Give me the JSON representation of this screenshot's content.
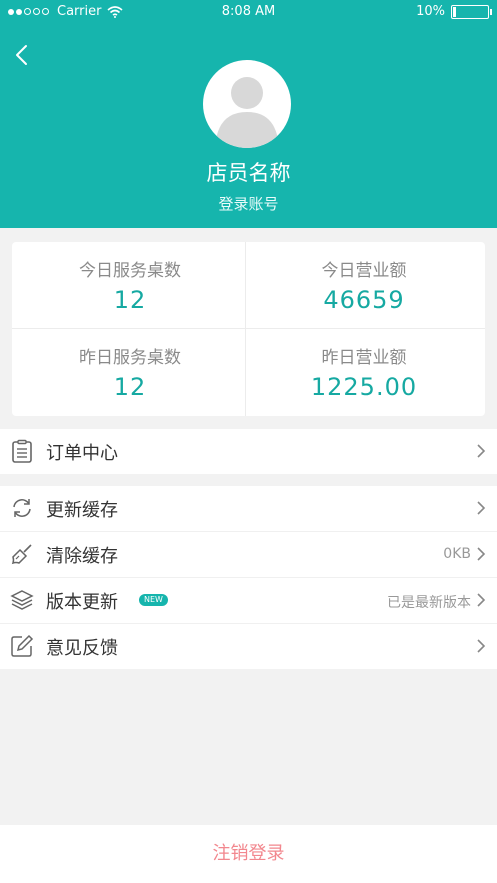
{
  "status_bar": {
    "carrier": "Carrier",
    "time": "8:08 AM",
    "battery": "10%",
    "battery_level": 0.1,
    "signal_bars": 2
  },
  "profile": {
    "name": "店员名称",
    "account": "登录账号",
    "back_icon": "chevron-left-icon",
    "avatar_icon": "user-avatar-icon"
  },
  "stats": [
    {
      "label": "今日服务桌数",
      "value": "12"
    },
    {
      "label": "今日营业额",
      "value": "46659"
    },
    {
      "label": "昨日服务桌数",
      "value": "12"
    },
    {
      "label": "昨日营业额",
      "value": "1225.00"
    }
  ],
  "menu": {
    "orders": {
      "label": "订单中心",
      "icon": "clipboard-icon"
    },
    "refresh_cache": {
      "label": "更新缓存",
      "icon": "refresh-icon"
    },
    "clear_cache": {
      "label": "清除缓存",
      "icon": "brush-icon",
      "value": "0KB"
    },
    "version": {
      "label": "版本更新",
      "icon": "layers-icon",
      "badge": "NEW",
      "value": "已是最新版本"
    },
    "feedback": {
      "label": "意见反馈",
      "icon": "edit-icon"
    }
  },
  "logout": {
    "label": "注销登录"
  },
  "colors": {
    "accent": "#16b5ad",
    "stat_value": "#16a9a2",
    "logout": "#f2878e",
    "background": "#f2f2f2"
  }
}
